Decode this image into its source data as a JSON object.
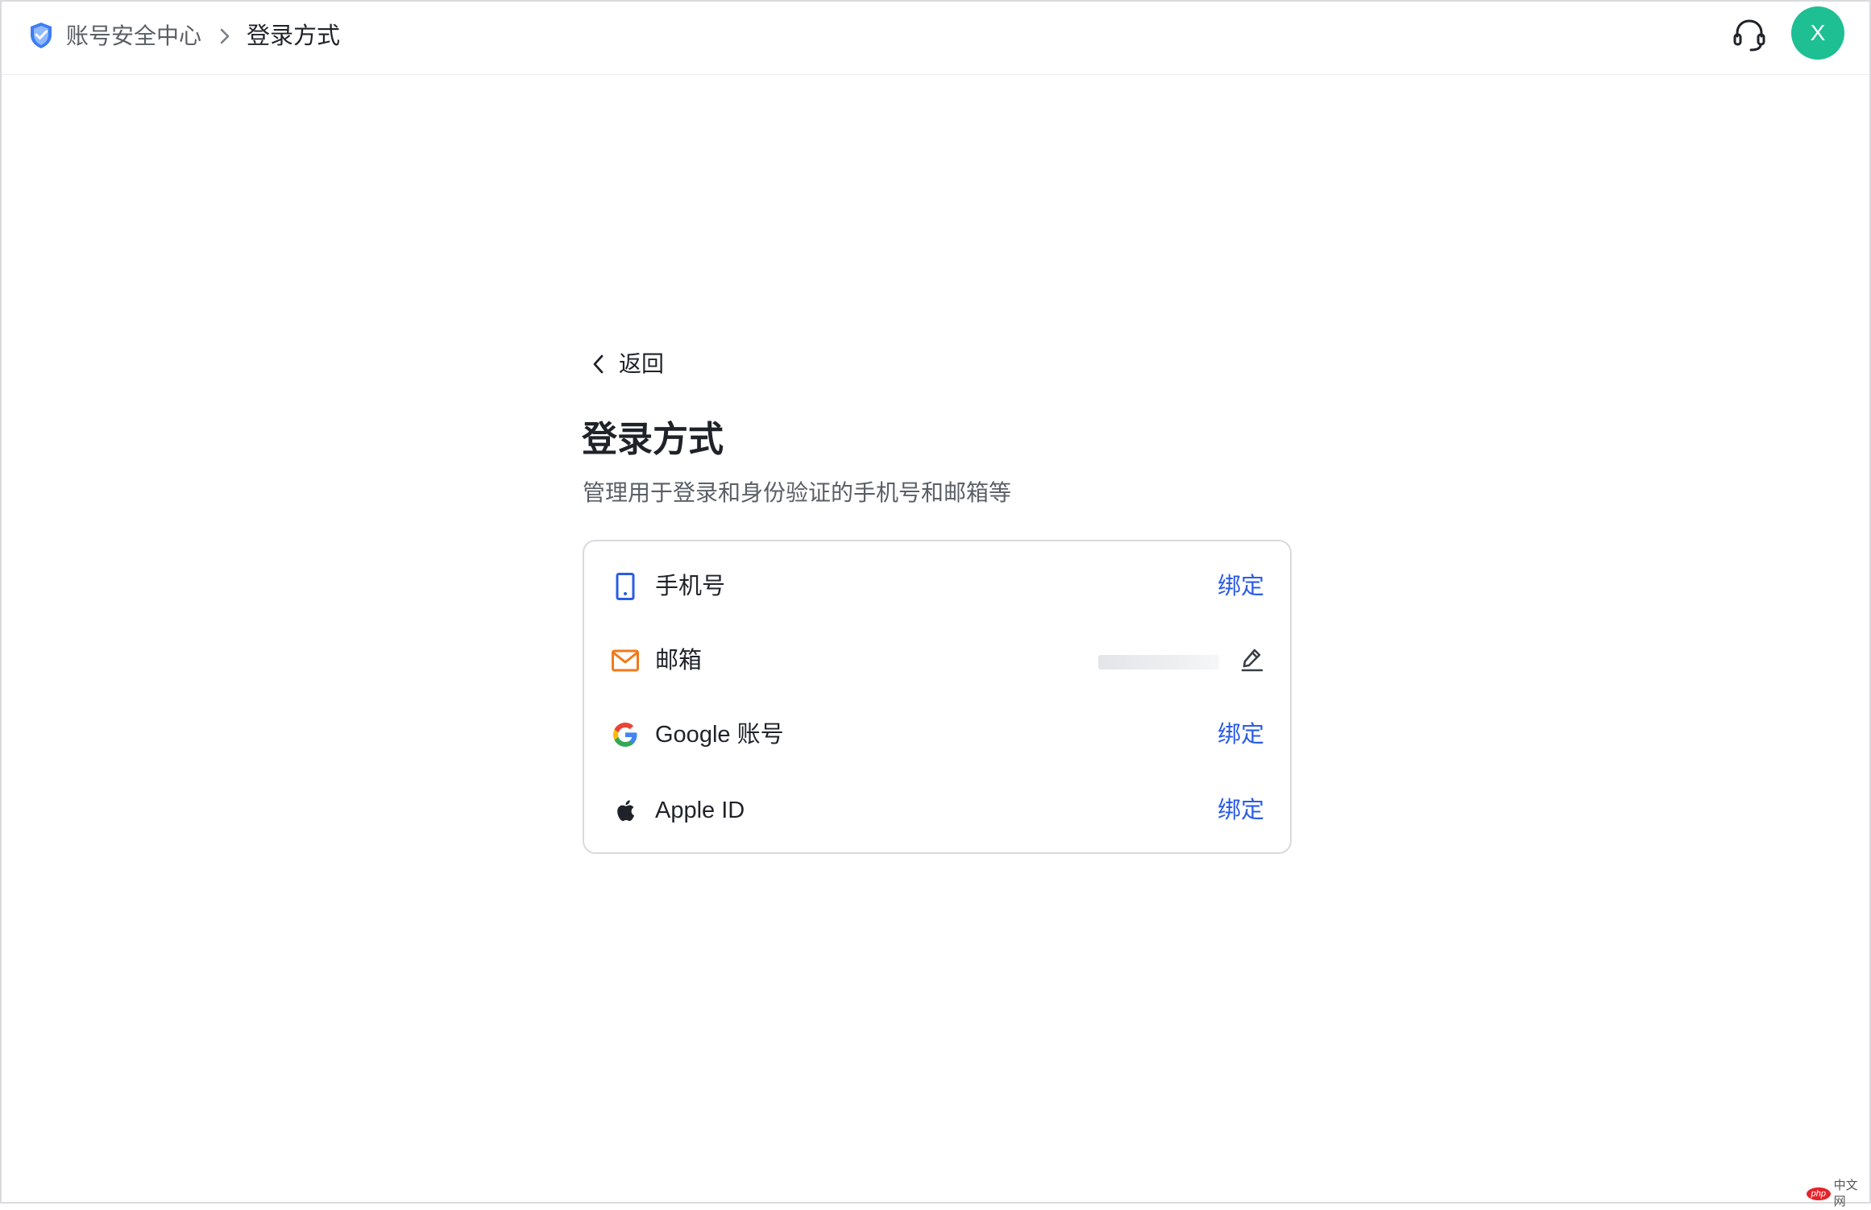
{
  "header": {
    "breadcrumb_root": "账号安全中心",
    "breadcrumb_current": "登录方式",
    "avatar_initial": "X",
    "icons": {
      "brand": "shield-icon",
      "separator": "chevron-right-icon",
      "support": "headset-icon"
    }
  },
  "main": {
    "back_label": "返回",
    "title": "登录方式",
    "subtitle": "管理用于登录和身份验证的手机号和邮箱等",
    "methods": [
      {
        "label": "手机号",
        "action": "绑定",
        "icon": "phone-icon",
        "icon_color": "#2b5ce6"
      },
      {
        "label": "邮箱",
        "value_masked": true,
        "action_icon": "edit-icon",
        "icon": "mail-icon",
        "icon_color": "#f07a1a"
      },
      {
        "label": "Google 账号",
        "action": "绑定",
        "icon": "google-icon"
      },
      {
        "label": "Apple ID",
        "action": "绑定",
        "icon": "apple-icon"
      }
    ]
  },
  "colors": {
    "accent_link": "#2b5ce6",
    "avatar_bg": "#1fbf94",
    "mail_icon": "#f07a1a"
  },
  "watermark": {
    "logo_text": "php",
    "text": "中文网"
  }
}
